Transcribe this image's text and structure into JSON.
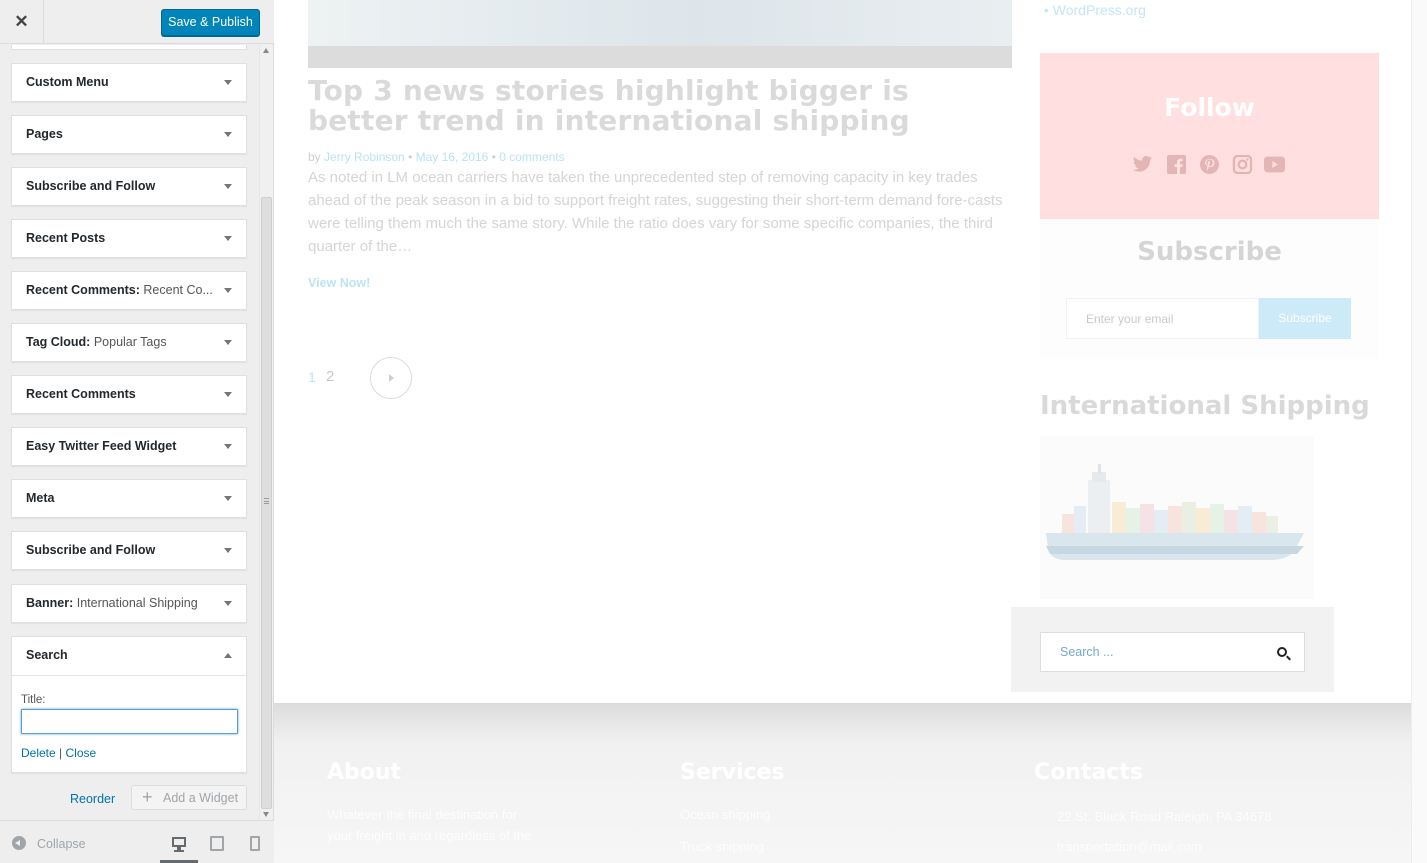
{
  "customizer": {
    "close_label": "✕",
    "publish_label": "Save & Publish",
    "widgets": [
      {
        "title": "Custom Menu",
        "subtitle": ""
      },
      {
        "title": "Pages",
        "subtitle": ""
      },
      {
        "title": "Subscribe and Follow",
        "subtitle": ""
      },
      {
        "title": "Recent Posts",
        "subtitle": ""
      },
      {
        "title": "Recent Comments:",
        "subtitle": "Recent Co..."
      },
      {
        "title": "Tag Cloud:",
        "subtitle": "Popular Tags"
      },
      {
        "title": "Recent Comments",
        "subtitle": ""
      },
      {
        "title": "Easy Twitter Feed Widget",
        "subtitle": ""
      },
      {
        "title": "Meta",
        "subtitle": ""
      },
      {
        "title": "Subscribe and Follow",
        "subtitle": ""
      },
      {
        "title": "Banner:",
        "subtitle": "International Shipping"
      }
    ],
    "open_widget": {
      "title": "Search",
      "field_label": "Title:",
      "field_value": "",
      "delete_label": "Delete",
      "separator": "|",
      "close_label": "Close"
    },
    "reorder_label": "Reorder",
    "add_widget_label": "Add a Widget",
    "collapse_label": "Collapse",
    "devices": [
      "desktop",
      "tablet",
      "mobile"
    ],
    "accent_color": "#0085ba"
  },
  "preview": {
    "post_title": "Top 3 news stories highlight bigger is better trend in international shipping",
    "meta_by": "by",
    "meta_author": "Jerry Robinson",
    "meta_dot": "•",
    "meta_date": "May 16, 2016",
    "meta_comments": "0 comments",
    "excerpt": "As noted in LM ocean carriers have taken the unprecedented step of removing capacity in key trades ahead of the peak season in a bid to support freight rates, suggesting their short-term demand fore-casts were telling them much the same story. While the ratio does vary for some specific companies, the third quarter of the…",
    "view_now": "View Now!",
    "page_current": "1",
    "page_next": "2",
    "sidebar_link": "• WordPress.org",
    "follow_title": "Follow",
    "social_icons": [
      "twitter-icon",
      "facebook-icon",
      "pinterest-icon",
      "instagram-icon",
      "youtube-icon"
    ],
    "subscribe_title": "Subscribe",
    "email_placeholder": "Enter your email",
    "subscribe_button": "Subscribe",
    "banner_title": "International Shipping",
    "search_placeholder": "Search ...",
    "footer": {
      "about_title": "About",
      "about_text_1": "Whatever the final destination for",
      "about_text_2": "your freight in and regardless of the",
      "services_title": "Services",
      "service_1": "Ocean shipping",
      "service_2": "Truck shipping",
      "contacts_title": "Contacts",
      "address": "22 St. Black Road Raleigh, PA 34678",
      "email": "transportation@mail.com"
    }
  }
}
